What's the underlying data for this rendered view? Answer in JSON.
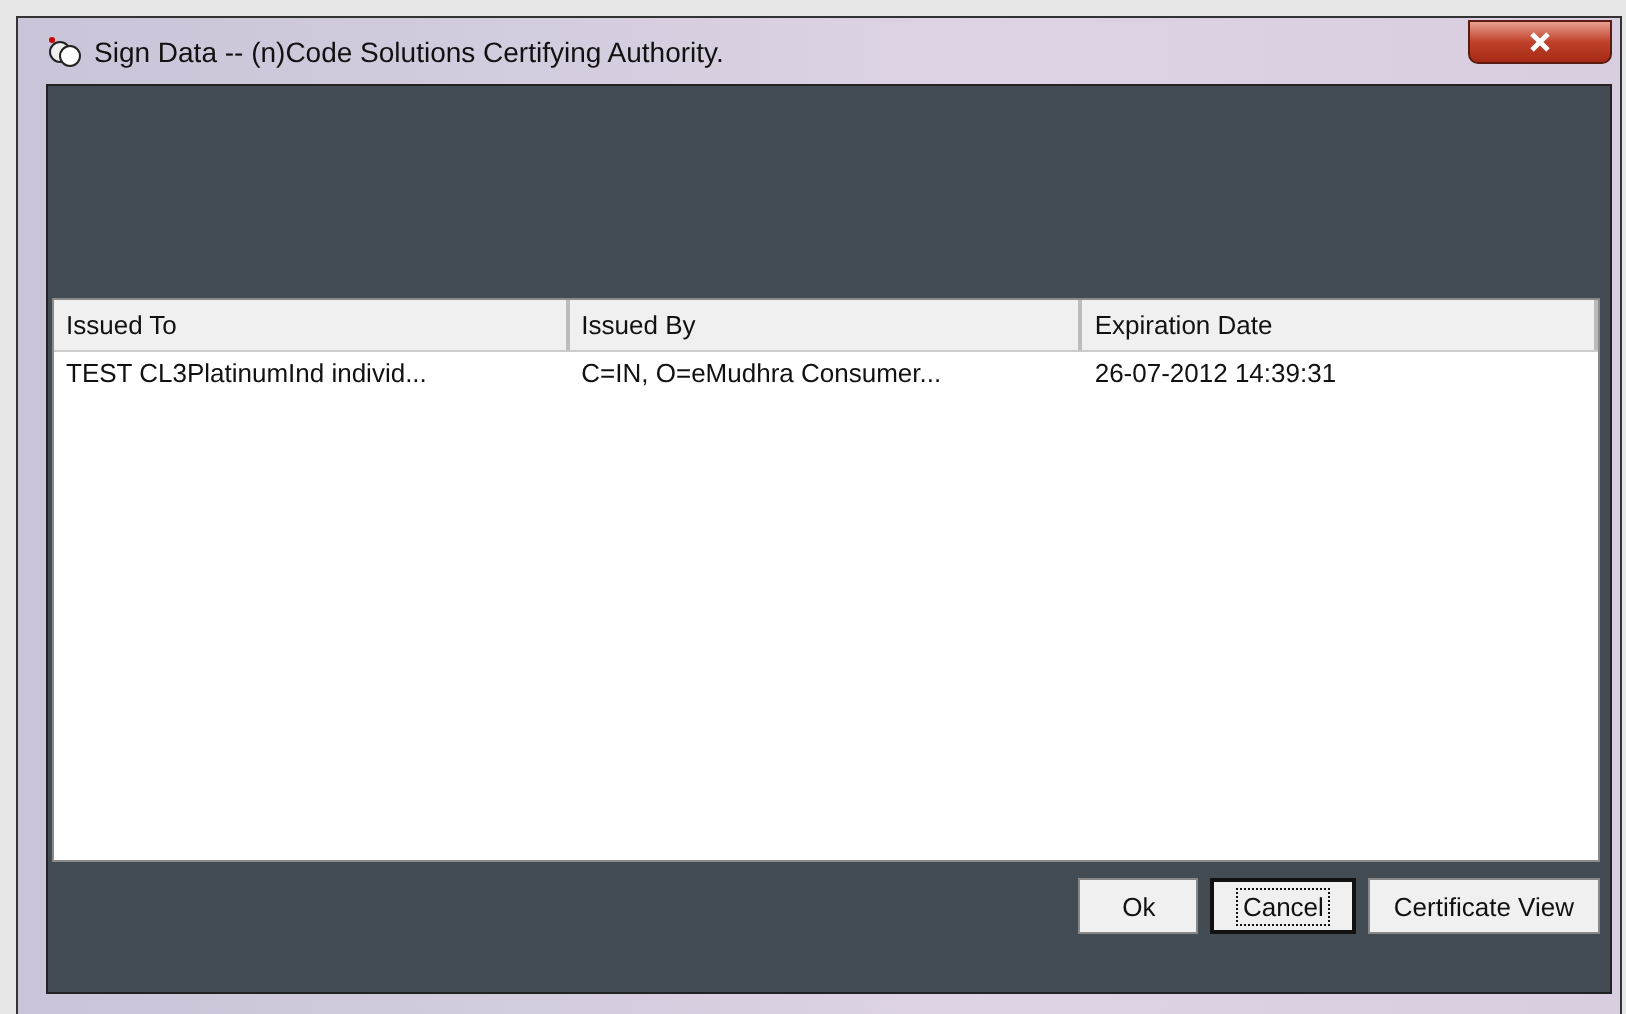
{
  "window": {
    "title": "Sign Data --  (n)Code Solutions Certifying Authority."
  },
  "table": {
    "columns": [
      "Issued To",
      "Issued By",
      "Expiration Date"
    ],
    "rows": [
      {
        "cells": [
          "TEST CL3PlatinumInd individ...",
          "C=IN, O=eMudhra Consumer...",
          "26-07-2012 14:39:31"
        ],
        "selected": false
      }
    ]
  },
  "buttons": [
    {
      "label": "Ok",
      "focused": false
    },
    {
      "label": "Cancel",
      "focused": true
    },
    {
      "label": "Certificate View",
      "focused": false
    }
  ]
}
